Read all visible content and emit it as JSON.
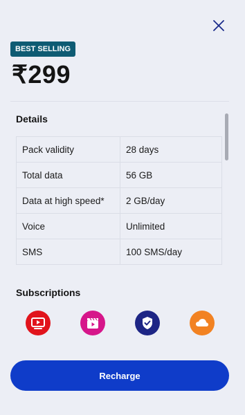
{
  "header": {
    "close_icon": "close-icon"
  },
  "plan": {
    "badge": "BEST SELLING",
    "price": "₹299"
  },
  "details": {
    "title": "Details",
    "rows": [
      {
        "label": "Pack validity",
        "value": "28 days"
      },
      {
        "label": "Total data",
        "value": "56 GB"
      },
      {
        "label": "Data at high speed*",
        "value": "2 GB/day"
      },
      {
        "label": "Voice",
        "value": "Unlimited"
      },
      {
        "label": "SMS",
        "value": "100 SMS/day"
      }
    ]
  },
  "subscriptions": {
    "title": "Subscriptions",
    "apps": [
      {
        "icon": "video-play-icon",
        "color": "#e1141c"
      },
      {
        "icon": "clapperboard-icon",
        "color": "#d6168a"
      },
      {
        "icon": "shield-check-icon",
        "color": "#1d2585"
      },
      {
        "icon": "cloud-icon",
        "color": "#f28222"
      }
    ]
  },
  "footer": {
    "recharge_label": "Recharge",
    "button_color": "#0f3cc9"
  },
  "colors": {
    "badge_bg": "#0e5b73",
    "page_bg": "#eceef5"
  }
}
